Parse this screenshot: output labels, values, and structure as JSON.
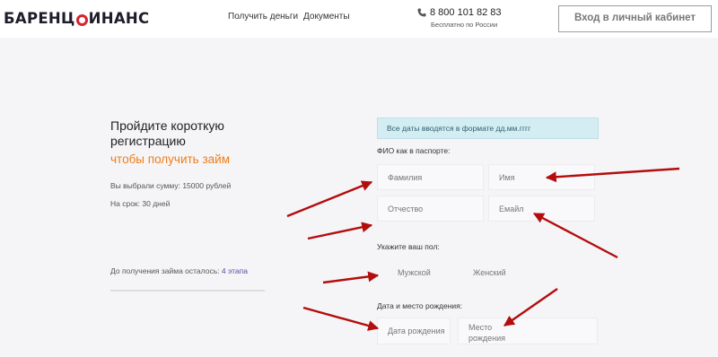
{
  "header": {
    "logo_left": "БАРЕНЦ",
    "logo_right": "ИНАНС",
    "nav": [
      "Получить деньги",
      "Документы"
    ],
    "phone": "8 800 101 82 83",
    "phone_note": "Бесплатно по России",
    "login_label": "Вход в личный кабинет"
  },
  "left_panel": {
    "title": "Пройдите короткую регистрацию",
    "subtitle": "чтобы получить займ",
    "amount_text": "Вы выбрали сумму: 15000 рублей",
    "term_text": "На срок: 30 дней",
    "steps_prefix": "До получения займа осталось:",
    "steps_count": "4 этапа",
    "progress": 0
  },
  "form": {
    "info": "Все даты вводятся в формате дд.мм.гггг",
    "fio_label": "ФИО как в паспорте:",
    "surname_placeholder": "Фамилия",
    "name_placeholder": "Имя",
    "patronymic_placeholder": "Отчество",
    "email_placeholder": "Емайл",
    "gender_label": "Укажите ваш пол:",
    "gender_male": "Мужской",
    "gender_female": "Женский",
    "birth_label": "Дата и место рождения:",
    "birth_date_placeholder": "Дата рождения",
    "birth_place_line1": "Место",
    "birth_place_line2": "рождения"
  },
  "colors": {
    "accent": "#ef7d1a",
    "brand_red": "#d62430",
    "arrow": "#b30d0d",
    "info_bg": "#d3edf3"
  }
}
